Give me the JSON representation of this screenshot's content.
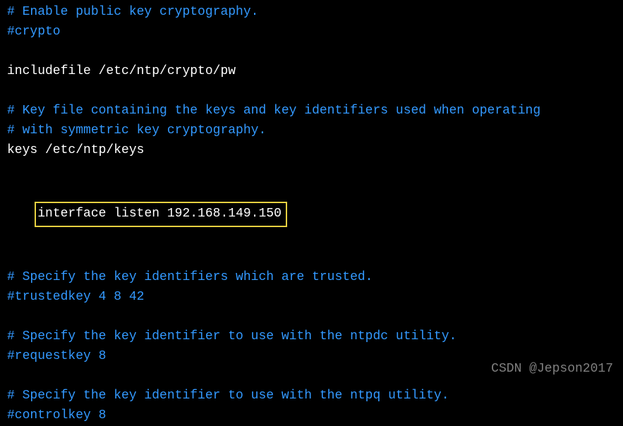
{
  "lines": {
    "l1": "# Enable public key cryptography.",
    "l2": "#crypto",
    "l3": "",
    "l4": "includefile /etc/ntp/crypto/pw",
    "l5": "",
    "l6": "# Key file containing the keys and key identifiers used when operating",
    "l7": "# with symmetric key cryptography.",
    "l8": "keys /etc/ntp/keys",
    "l9": "",
    "l10": "interface listen 192.168.149.150",
    "l11": "",
    "l12": "# Specify the key identifiers which are trusted.",
    "l13": "#trustedkey 4 8 42",
    "l14": "",
    "l15": "# Specify the key identifier to use with the ntpdc utility.",
    "l16": "#requestkey 8",
    "l17": "",
    "l18": "# Specify the key identifier to use with the ntpq utility.",
    "l19": "#controlkey 8"
  },
  "watermark": "CSDN @Jepson2017"
}
